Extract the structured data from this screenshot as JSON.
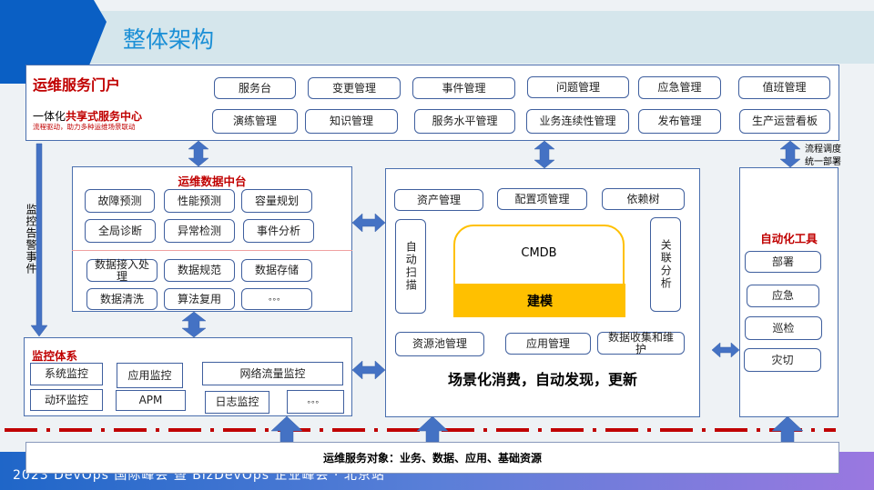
{
  "title": "整体架构",
  "portal": {
    "title": "运维服务门户",
    "subtitle_plain": "一体化",
    "subtitle_bold": "共享式服务中心",
    "tagline": "流程驱动，助力多种运维场景联动",
    "row1": [
      "服务台",
      "变更管理",
      "事件管理",
      "问题管理",
      "应急管理",
      "值班管理"
    ],
    "row2": [
      "演练管理",
      "知识管理",
      "服务水平管理",
      "业务连续性管理",
      "发布管理",
      "生产运营看板"
    ]
  },
  "data_platform": {
    "title": "运维数据中台",
    "items": [
      "故障预测",
      "性能预测",
      "容量规划",
      "全局诊断",
      "异常检测",
      "事件分析",
      "数据接入处理",
      "数据规范",
      "数据存储",
      "数据清洗",
      "算法复用",
      "。。。"
    ]
  },
  "monitor": {
    "title": "监控体系",
    "items": [
      "系统监控",
      "应用监控",
      "网络流量监控",
      "动环监控",
      "APM",
      "日志监控",
      "。。。"
    ],
    "side_label": "监控告警事件"
  },
  "cmdb": {
    "top": [
      "资产管理",
      "配置项管理",
      "依赖树"
    ],
    "left": "自动扫描",
    "right": "关联分析",
    "core": "CMDB",
    "modeling": "建模",
    "bottom": [
      "资源池管理",
      "应用管理",
      "数据收集和维护"
    ],
    "slogan": "场景化消费，自动发现，更新"
  },
  "automation": {
    "title": "自动化工具",
    "label": "流程调度统一部署",
    "items": [
      "部署",
      "应急",
      "巡检",
      "灾切"
    ]
  },
  "service_objects": "运维服务对象：业务、数据、应用、基础资源",
  "footer": "2023 DevOps 国际峰会 暨 BizDevOps 企业峰会 · 北京站",
  "colors": {
    "accent": "#1a8fd6",
    "title_red": "#c00000",
    "arrow": "#4472c4",
    "cmdb_yellow": "#ffc000",
    "dash": "#c00000"
  }
}
